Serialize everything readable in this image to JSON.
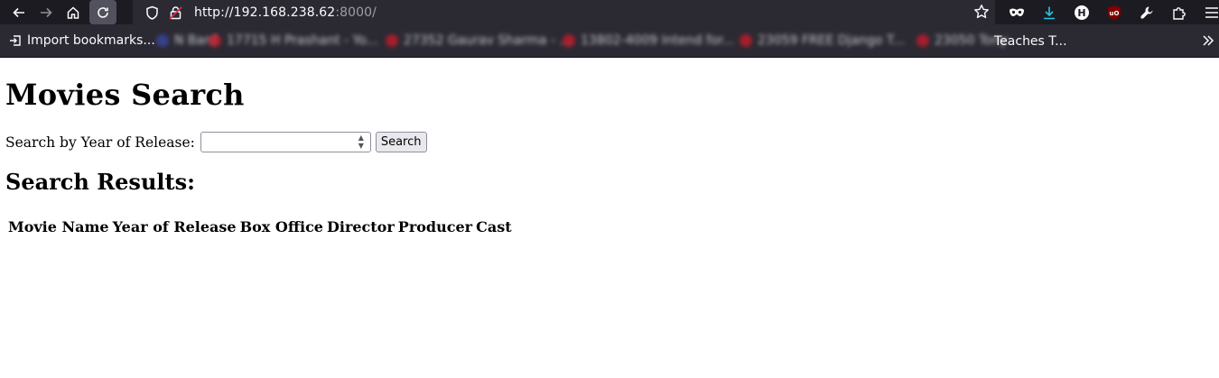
{
  "browser": {
    "url_host": "http://192.168.238.62",
    "url_port": ":8000/",
    "bookmarks": {
      "import_label": "Import bookmarks...",
      "blurred": [
        "N Bard",
        "17715 H Prashant - Yo...",
        "27352 Gaurav Sharma - ...",
        "13802-4009 Intend for...",
        "23059 FREE Django T...",
        "23050 Tony"
      ],
      "last_visible": "Teaches T..."
    }
  },
  "page": {
    "title": "Movies Search",
    "search": {
      "label": "Search by Year of Release:",
      "input_value": "",
      "button_label": "Search"
    },
    "results_title": "Search Results:",
    "table": {
      "columns": [
        "Movie Name",
        "Year of Release",
        "Box Office",
        "Director",
        "Producer",
        "Cast"
      ],
      "rows": []
    }
  },
  "colors": {
    "chrome_dark": "#1c1b22",
    "chrome_mid": "#2b2a33",
    "chrome_text": "#fbfbfe",
    "bookmark_favicon": "#d11a2a"
  }
}
